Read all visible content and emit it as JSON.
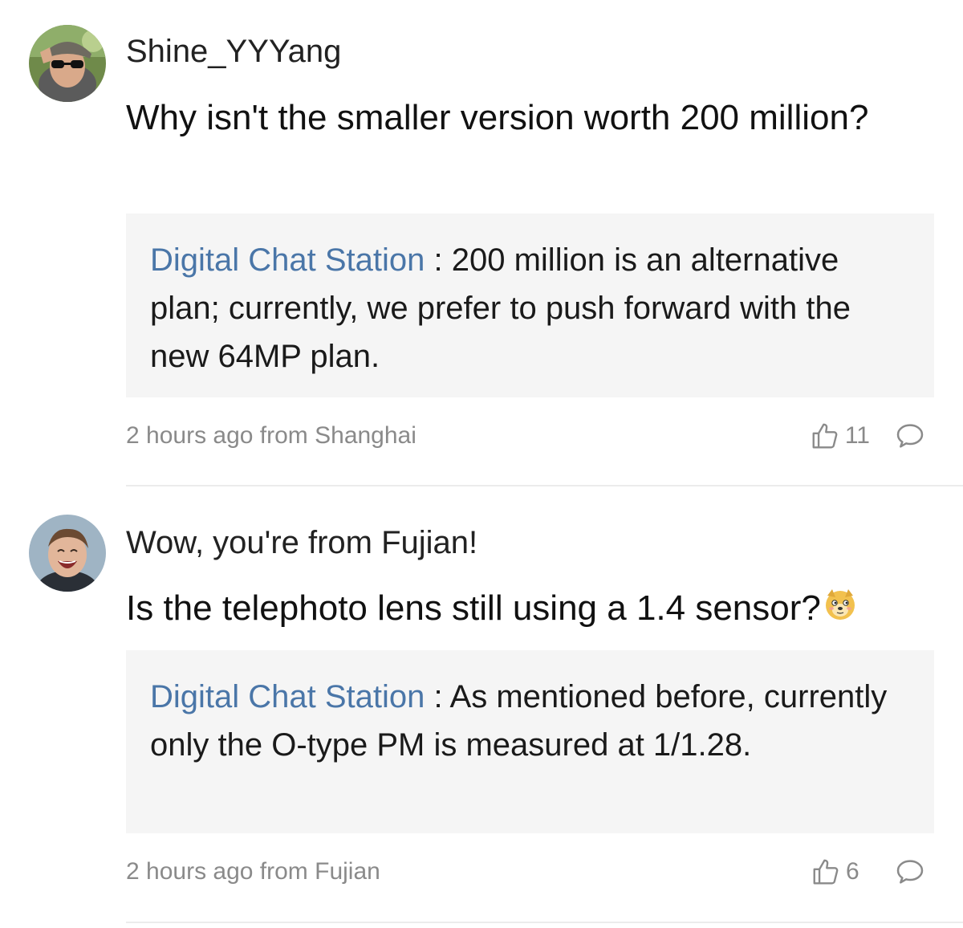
{
  "comments": [
    {
      "avatar_icon": "user-avatar-sunglasses-icon",
      "username": "Shine_YYYang",
      "text": "Why isn't the smaller version worth 200 million?",
      "reply": {
        "author": "Digital Chat Station",
        "separator": " : ",
        "text": "200 million is an alternative plan; currently, we prefer to push forward with the new 64MP plan."
      },
      "meta": "2 hours ago from Shanghai",
      "likes": "11"
    },
    {
      "avatar_icon": "user-avatar-laughing-child-icon",
      "username": "Wow, you're from Fujian!",
      "text": "Is the telephoto lens still using a 1.4 sensor?",
      "emoji_icon": "doge-emoji-icon",
      "reply": {
        "author": "Digital Chat Station",
        "separator": " : ",
        "text": "As mentioned before, currently only the O-type PM is measured at 1/1.28."
      },
      "meta": "2 hours ago from Fujian",
      "likes": "6"
    }
  ],
  "colors": {
    "reply_author": "#4a76a8",
    "reply_background": "#f5f5f5",
    "meta_text": "#8a8a8a"
  }
}
